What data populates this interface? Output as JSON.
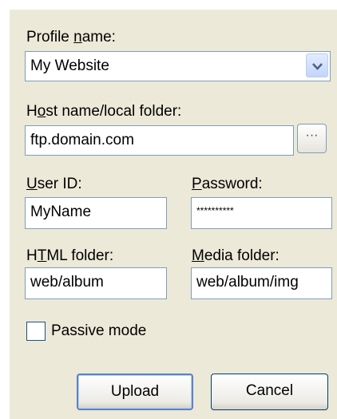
{
  "profile": {
    "label_pre": "Profile ",
    "label_key": "n",
    "label_post": "ame:",
    "value": "My Website"
  },
  "host": {
    "label_pre": "H",
    "label_key": "o",
    "label_post": "st name/local folder:",
    "value": "ftp.domain.com",
    "browse_label": "···"
  },
  "user": {
    "label_pre": "",
    "label_key": "U",
    "label_post": "ser ID:",
    "value": "MyName"
  },
  "password": {
    "label_pre": "",
    "label_key": "P",
    "label_post": "assword:",
    "value": "**********"
  },
  "html_folder": {
    "label_pre": "H",
    "label_key": "T",
    "label_post": "ML folder:",
    "value": "web/album"
  },
  "media_folder": {
    "label_pre": "",
    "label_key": "M",
    "label_post": "edia folder:",
    "value": "web/album/img"
  },
  "passive": {
    "label": "Passive mode",
    "checked": false
  },
  "buttons": {
    "upload": "Upload",
    "cancel": "Cancel"
  }
}
